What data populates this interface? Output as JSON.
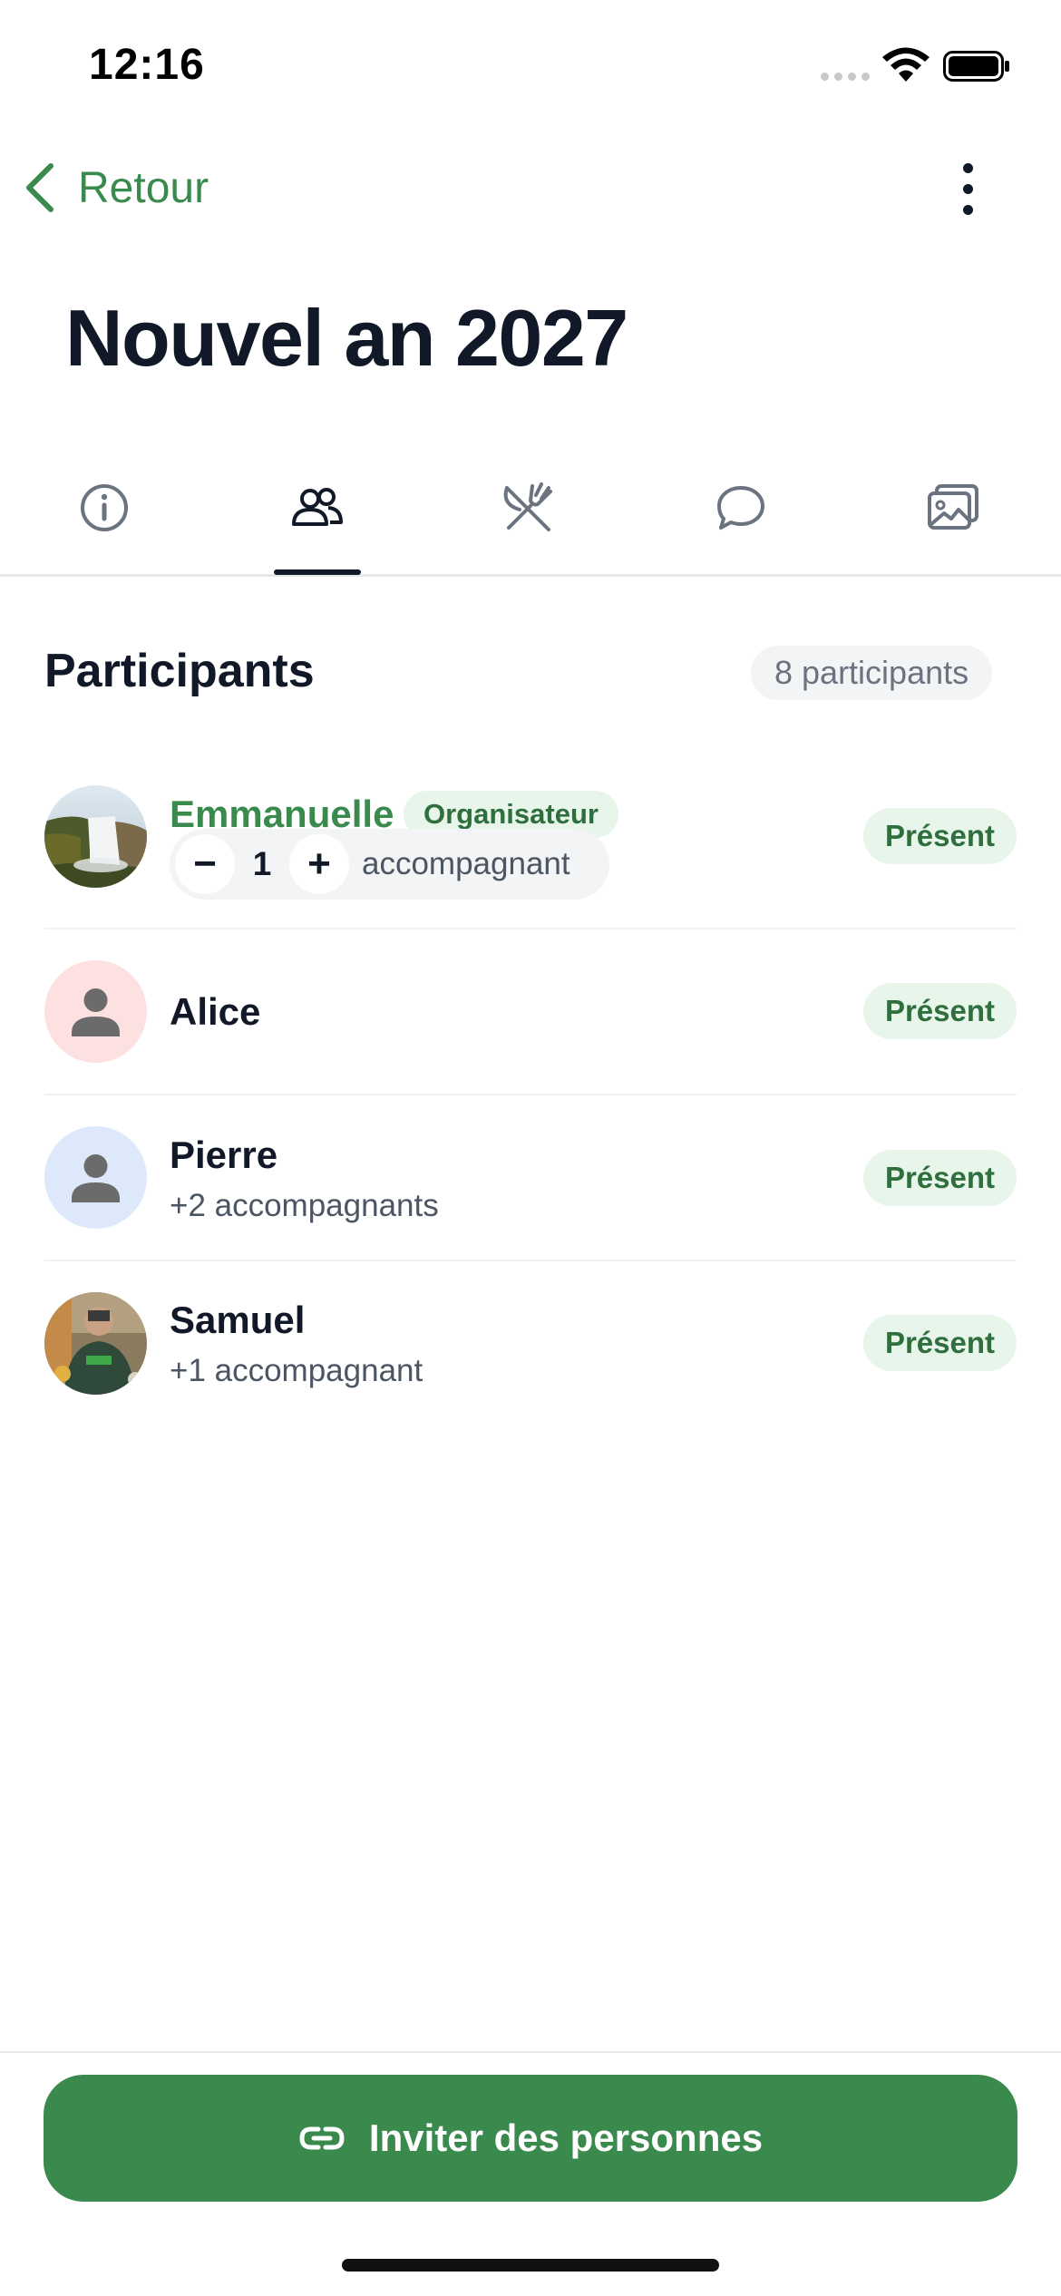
{
  "status_bar": {
    "time": "12:16"
  },
  "nav": {
    "back_label": "Retour"
  },
  "page": {
    "title": "Nouvel an 2027"
  },
  "tabs": [
    {
      "icon": "info-icon",
      "active": false
    },
    {
      "icon": "people-icon",
      "active": true
    },
    {
      "icon": "utensils-icon",
      "active": false
    },
    {
      "icon": "chat-icon",
      "active": false
    },
    {
      "icon": "photos-icon",
      "active": false
    }
  ],
  "participants": {
    "title": "Participants",
    "count_label": "8 participants",
    "items": [
      {
        "name": "Emmanuelle",
        "role_badge": "Organisateur",
        "stepper_value": "1",
        "stepper_label": "accompagnant",
        "status": "Présent",
        "avatar": "photo-waterfall"
      },
      {
        "name": "Alice",
        "status": "Présent",
        "avatar": "placeholder-pink"
      },
      {
        "name": "Pierre",
        "subtitle": "+2 accompagnants",
        "status": "Présent",
        "avatar": "placeholder-blue"
      },
      {
        "name": "Samuel",
        "subtitle": "+1 accompagnant",
        "status": "Présent",
        "avatar": "photo-person"
      }
    ]
  },
  "stepper_symbols": {
    "minus": "−",
    "plus": "+"
  },
  "footer": {
    "invite_label": "Inviter des personnes"
  },
  "colors": {
    "accent": "#3a8a4d",
    "status_bg": "#e8f5ea",
    "status_text": "#2f6f3e",
    "text": "#111827"
  }
}
